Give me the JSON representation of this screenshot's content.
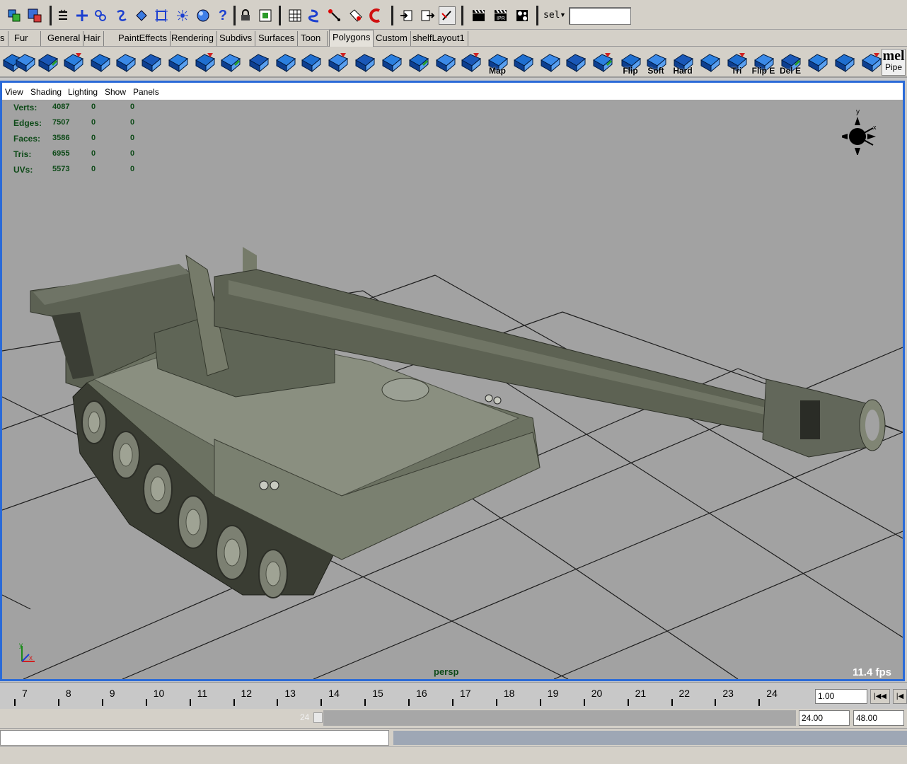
{
  "status_line": {
    "icons": [
      "select-by-hierarchy-icon",
      "select-by-object-type-icon",
      "menu-toggle-icon",
      "select-mode-plus-icon",
      "snap-to-grid-icon",
      "snap-to-curve-icon",
      "snap-to-point-icon",
      "snap-to-view-plane-icon",
      "make-live-icon",
      "ipr-render-icon",
      "help-icon",
      "lock-icon",
      "history-icon",
      "construction-history-icon",
      "magnet-icon",
      "input-connection-icon",
      "output-connection-icon",
      "render-icon",
      "render-ipr-icon",
      "render-globals-icon"
    ],
    "selection_label": "sel",
    "selection_value": ""
  },
  "shelf_tabs": [
    {
      "label": "s"
    },
    {
      "label": "Fur"
    },
    {
      "label": "General"
    },
    {
      "label": "Hair"
    },
    {
      "label": "PaintEffects"
    },
    {
      "label": "Rendering"
    },
    {
      "label": "Subdivs"
    },
    {
      "label": "Surfaces"
    },
    {
      "label": "Toon"
    },
    {
      "label": "Polygons"
    },
    {
      "label": "Custom"
    },
    {
      "label": "shelfLayout1"
    }
  ],
  "active_shelf_tab": "Polygons",
  "shelf_buttons": [
    {
      "icon": "poly-sphere-icon",
      "caption": ""
    },
    {
      "icon": "poly-cube-icon",
      "caption": ""
    },
    {
      "icon": "poly-cylinder-icon",
      "caption": ""
    },
    {
      "icon": "poly-cone-icon",
      "caption": ""
    },
    {
      "icon": "poly-plane-icon",
      "caption": ""
    },
    {
      "icon": "poly-torus-icon",
      "caption": ""
    },
    {
      "icon": "combine-icon",
      "caption": ""
    },
    {
      "icon": "separate-icon",
      "caption": ""
    },
    {
      "icon": "extract-icon",
      "caption": ""
    },
    {
      "icon": "smooth-icon",
      "caption": ""
    },
    {
      "icon": "reduce-icon",
      "caption": ""
    },
    {
      "icon": "bevel-icon",
      "caption": ""
    },
    {
      "icon": "split-polygon-icon",
      "caption": ""
    },
    {
      "icon": "extrude-face-icon",
      "caption": ""
    },
    {
      "icon": "extrude-edge-icon",
      "caption": ""
    },
    {
      "icon": "merge-vertices-icon",
      "caption": ""
    },
    {
      "icon": "bridge-icon",
      "caption": ""
    },
    {
      "icon": "append-polygon-icon",
      "caption": ""
    },
    {
      "icon": "planar-map-icon",
      "caption": ""
    },
    {
      "icon": "map-uv-icon",
      "caption": "Map"
    },
    {
      "icon": "cylindrical-map-icon",
      "caption": ""
    },
    {
      "icon": "spherical-map-icon",
      "caption": ""
    },
    {
      "icon": "automatic-map-icon",
      "caption": ""
    },
    {
      "icon": "uv-texture-editor-icon",
      "caption": ""
    },
    {
      "icon": "flip-normals-icon",
      "caption": "Flip"
    },
    {
      "icon": "soften-edge-icon",
      "caption": "Soft"
    },
    {
      "icon": "harden-edge-icon",
      "caption": "Hard"
    },
    {
      "icon": "triangulate-icon",
      "caption": ""
    },
    {
      "icon": "quadrangulate-icon",
      "caption": "Tri"
    },
    {
      "icon": "flip-edge-icon",
      "caption": "Flip E"
    },
    {
      "icon": "delete-edge-icon",
      "caption": "Del E"
    },
    {
      "icon": "cut-faces-icon",
      "caption": ""
    },
    {
      "icon": "checker-map-icon",
      "caption": ""
    },
    {
      "icon": "checker-map-2-icon",
      "caption": ""
    },
    {
      "icon": "uv-snapshot-icon",
      "caption": ""
    },
    {
      "icon": "paint-texture-icon",
      "caption": ""
    }
  ],
  "shelf_mel": {
    "top": "mel",
    "bottom": "Pipe"
  },
  "viewport": {
    "menus": [
      "View",
      "Shading",
      "Lighting",
      "Show",
      "Panels"
    ],
    "hud_rows": [
      {
        "key": "Verts:",
        "v1": "4087",
        "v2": "0",
        "v3": "0"
      },
      {
        "key": "Edges:",
        "v1": "7507",
        "v2": "0",
        "v3": "0"
      },
      {
        "key": "Faces:",
        "v1": "3586",
        "v2": "0",
        "v3": "0"
      },
      {
        "key": "Tris:",
        "v1": "6955",
        "v2": "0",
        "v3": "0"
      },
      {
        "key": "UVs:",
        "v1": "5573",
        "v2": "0",
        "v3": "0"
      }
    ],
    "camera": "persp",
    "fps": "11.4 fps",
    "background_color": "#a2a2a2",
    "hud_color": "#0e4a18",
    "frame_color": "#2a6ad8"
  },
  "time_slider": {
    "ticks": [
      "7",
      "8",
      "9",
      "10",
      "11",
      "12",
      "13",
      "14",
      "15",
      "16",
      "17",
      "18",
      "19",
      "20",
      "21",
      "22",
      "23",
      "24"
    ],
    "current_frame": "1.00",
    "playback_icons": [
      "go-to-start-icon",
      "step-back-icon"
    ]
  },
  "range_slider": {
    "handle_label": "24",
    "end_time": "24.00",
    "playback_end": "48.00"
  },
  "command_line": {
    "input": "",
    "result": ""
  }
}
